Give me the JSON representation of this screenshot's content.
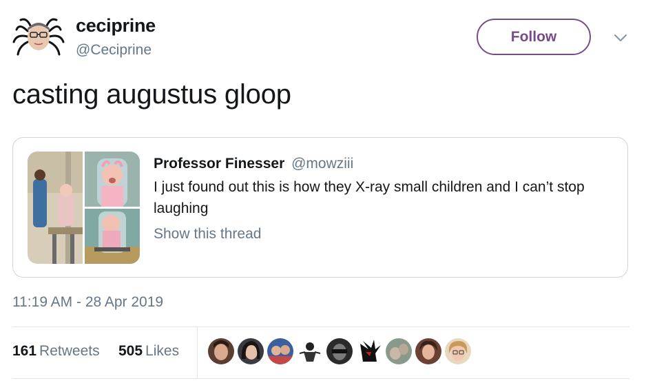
{
  "author": {
    "display_name": "ceciprine",
    "handle": "@Ceciprine",
    "follow_label": "Follow"
  },
  "tweet": {
    "text": "casting augustus gloop",
    "timestamp": "11:19 AM - 28 Apr 2019"
  },
  "quoted_tweet": {
    "display_name": "Professor Finesser",
    "handle": "@mowziii",
    "text": "I just found out this is how they X-ray small children and I can’t stop laughing",
    "thread_link": "Show this thread"
  },
  "stats": {
    "retweets_count": "161",
    "retweets_label": "Retweets",
    "likes_count": "505",
    "likes_label": "Likes"
  },
  "colors": {
    "follow_accent": "#794a8a",
    "secondary_text": "#657786",
    "border": "#ccd6dd"
  },
  "likers": [
    {
      "icon": "avatar-photo"
    },
    {
      "icon": "avatar-photo"
    },
    {
      "icon": "avatar-photo"
    },
    {
      "icon": "avatar-cartoon"
    },
    {
      "icon": "avatar-photo"
    },
    {
      "icon": "avatar-cartoon"
    },
    {
      "icon": "avatar-photo"
    },
    {
      "icon": "avatar-photo"
    },
    {
      "icon": "avatar-photo"
    }
  ]
}
